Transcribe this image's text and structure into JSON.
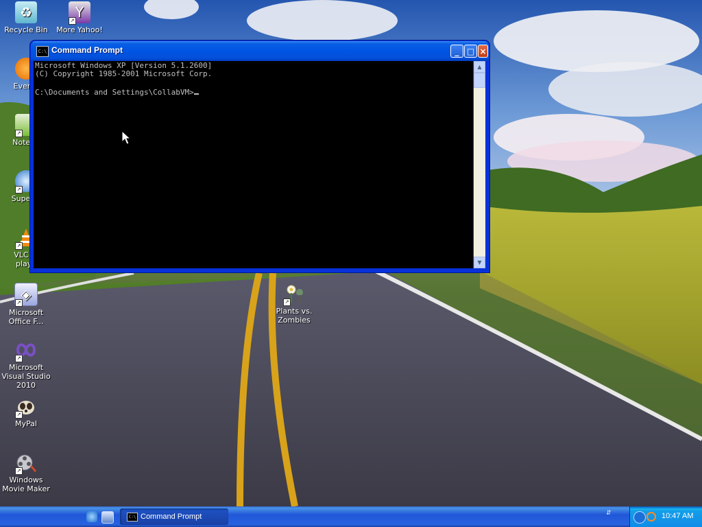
{
  "desktop": {
    "icons": [
      {
        "label": "Recycle Bin",
        "icon": "recycle-bin-icon"
      },
      {
        "label": "More Yahoo! Games",
        "icon": "yahoo-games-icon"
      },
      {
        "label": "Everys",
        "icon": "everything-search-icon"
      },
      {
        "label": "Notepa",
        "icon": "notepad-icon"
      },
      {
        "label": "Superm",
        "icon": "supermium-browser-icon"
      },
      {
        "label": "VLC m",
        "label2": "playe",
        "icon": "vlc-cone-icon"
      },
      {
        "label": "Microsoft Office F...",
        "icon": "office-icon"
      },
      {
        "label": "Plants vs. Zombies",
        "icon": "plants-vs-zombies-icon"
      },
      {
        "label": "Microsoft Visual Studio 2010",
        "icon": "visual-studio-icon"
      },
      {
        "label": "MyPal",
        "icon": "mypal-browser-icon"
      },
      {
        "label": "Windows Movie Maker",
        "icon": "movie-maker-icon"
      }
    ]
  },
  "window": {
    "title": "Command Prompt",
    "console_lines": [
      "Microsoft Windows XP [Version 5.1.2600]",
      "(C) Copyright 1985-2001 Microsoft Corp.",
      "",
      "C:\\Documents and Settings\\CollabVM>"
    ],
    "buttons": {
      "minimize": "_",
      "maximize": "□",
      "close": "×"
    }
  },
  "taskbar": {
    "tasks": [
      {
        "label": "Command Prompt",
        "icon": "command-prompt-icon"
      }
    ],
    "quick_launch": [
      "internet-explorer-icon",
      "show-desktop-icon"
    ],
    "clock": "10:47 AM"
  },
  "colors": {
    "xp_blue_title": "#0054e3",
    "console_bg": "#000000",
    "console_fg": "#c0c0c0",
    "taskbar_blue": "#2157d7",
    "tray_blue": "#139ee9"
  }
}
